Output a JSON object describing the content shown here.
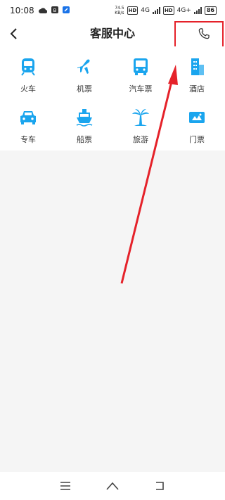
{
  "status": {
    "time": "10:08",
    "net_speed_value": "74.5",
    "net_speed_unit": "KB/s",
    "network_1": "4G",
    "network_2": "4G+",
    "battery": "86",
    "sim_1": "HD",
    "sim_2": "HD"
  },
  "header": {
    "title": "客服中心"
  },
  "services": [
    {
      "label": "火车",
      "icon": "train-icon"
    },
    {
      "label": "机票",
      "icon": "plane-icon"
    },
    {
      "label": "汽车票",
      "icon": "bus-icon"
    },
    {
      "label": "酒店",
      "icon": "hotel-icon"
    },
    {
      "label": "专车",
      "icon": "car-icon"
    },
    {
      "label": "船票",
      "icon": "ship-icon"
    },
    {
      "label": "旅游",
      "icon": "palm-tree-icon"
    },
    {
      "label": "门票",
      "icon": "ticket-icon"
    }
  ],
  "colors": {
    "accent": "#1aa5ee",
    "highlight": "#e5222a"
  }
}
